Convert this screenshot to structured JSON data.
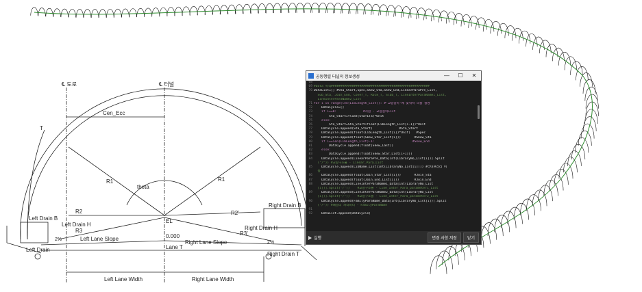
{
  "drawing": {
    "labels": {
      "cl_road": "℄ 도로",
      "cl_tunnel": "℄ 터널",
      "cen_ecc": "Cen_Ecc",
      "r1_left": "R1",
      "r1_right": "R1",
      "theta": "theta",
      "r2_left": "R2",
      "r2_right": "R2'",
      "r3_left": "R3",
      "r3_right": "R3'",
      "el": "EL",
      "zero": "0.000",
      "left_drain_b": "Left Drain B",
      "left_drain_h": "Left Drain H",
      "left_drain_t": "Left Drain",
      "right_drain_b": "Right Drain B",
      "right_drain_h": "Right Drain H",
      "right_drain_t": "Right Drain T",
      "left_lane_slope": "Left Lane Slope",
      "right_lane_slope": "Right Lane Slope",
      "lane_t": "Lane T",
      "slope_left": "2%",
      "slope_right": "2%",
      "left_lane_width": "Left Lane Width",
      "right_lane_width": "Right Lane Width",
      "small_dim": "T"
    }
  },
  "editor": {
    "title": "공동행렬 터널의 정보생성",
    "window_buttons": {
      "minimize": "—",
      "maximize": "☐",
      "close": "✕"
    },
    "code_lines": [
      {
        "n": "68",
        "t": "",
        "c": ""
      },
      {
        "n": "69",
        "t": "#Data 목적####################################################",
        "c": "cmt"
      },
      {
        "n": "70",
        "t": "DataList=[] #Sta_Start,Spec,Skew_Sta,Skew_End,LinearParaPre_List,",
        "c": ""
      },
      {
        "n": "",
        "t": "  Sub_Sta, Join_End, Cover_T, Rock_T, Slab_T, LineInterParaName1_List,",
        "c": "cmt"
      },
      {
        "n": "",
        "t": "  LineInterParaName2_List",
        "c": "cmt"
      },
      {
        "n": "71",
        "t": "for i in range(len(LibLength_List)): #'교량길이'에 맞춰서 리플 생성",
        "c": "kw"
      },
      {
        "n": "72",
        "t": "    DataCycle=[]",
        "c": ""
      },
      {
        "n": "73",
        "t": "    if i==0:              #시점 - 교량길이List",
        "c": "kw"
      },
      {
        "n": "74",
        "t": "        Sta_Start=float(Sta+ETa)*Unit",
        "c": ""
      },
      {
        "n": "75",
        "t": "    else:",
        "c": "kw"
      },
      {
        "n": "76",
        "t": "        Sta_Start=Sta_Start+float(LibLength_List[i-1])*Unit",
        "c": ""
      },
      {
        "n": "77",
        "t": "    DataCycle.append(Sta_Start)              #Sta_Start",
        "c": ""
      },
      {
        "n": "78",
        "t": "    DataCycle.append(float(LibLength_List[i])*Unit)   #Spec",
        "c": ""
      },
      {
        "n": "79",
        "t": "    DataCycle.append(float(Skew_Star_List[i]))       #Skew_Sta",
        "c": ""
      },
      {
        "n": "80",
        "t": "    if i==len(LibLength_List)-1:                    #Skew_End",
        "c": "kw"
      },
      {
        "n": "81",
        "t": "        DataCycle.append(float(Skew_Last))",
        "c": ""
      },
      {
        "n": "82",
        "t": "    else:",
        "c": "kw"
      },
      {
        "n": "83",
        "t": "        DataCycle.append(float(Skew_Star_List[i+1]))",
        "c": ""
      },
      {
        "n": "84",
        "t": "    DataCycle.append(LinearParaPre_Data[int(LibraryNo_List[i])].Split",
        "c": ""
      },
      {
        "n": "",
        "t": "  (\"/\")) #교량구조물 - Linear_Para_List",
        "c": "cmt"
      },
      {
        "n": "85",
        "t": "    DataCycle.append(LibName_List[int(LibraryNo_List[i])]) #라이브러리 이",
        "c": ""
      },
      {
        "n": "",
        "t": "  름",
        "c": "cmt"
      },
      {
        "n": "86",
        "t": "    DataCycle.append(float(Join_Star_List[i]))       #Join_Sta",
        "c": ""
      },
      {
        "n": "87",
        "t": "    DataCycle.append(float(Join_End_List[i]))        #Join_End",
        "c": ""
      },
      {
        "n": "88",
        "t": "    DataCycle.append(LineInterParaName1_Data[int(LibraryNo_List",
        "c": ""
      },
      {
        "n": "",
        "t": "  [i])].Split(\"/\"))    #교량구조물 - Line_Inter_Para_parameter1_List",
        "c": "cmt"
      },
      {
        "n": "89",
        "t": "    DataCycle.append(LineInterParaName2_Data[int(LibraryNo_List",
        "c": ""
      },
      {
        "n": "",
        "t": "  [i])].Split(\"/\"))    #교량구조물 - Line_Inter_Para_parameter2_List",
        "c": "cmt"
      },
      {
        "n": "90",
        "t": "    DataCycle.append(FamilyParaName_Data[int(LibraryNo_List[i])].Split",
        "c": ""
      },
      {
        "n": "",
        "t": "  (\"/\")) #패밀리 파라미터 - FamilyParaName",
        "c": "cmt"
      },
      {
        "n": "91",
        "t": "",
        "c": ""
      },
      {
        "n": "92",
        "t": "    DataList.append(DataCycle)",
        "c": ""
      }
    ],
    "bottom": {
      "run_label": "실행",
      "save_label": "변경 사항 저장",
      "close_label": "닫기"
    }
  }
}
